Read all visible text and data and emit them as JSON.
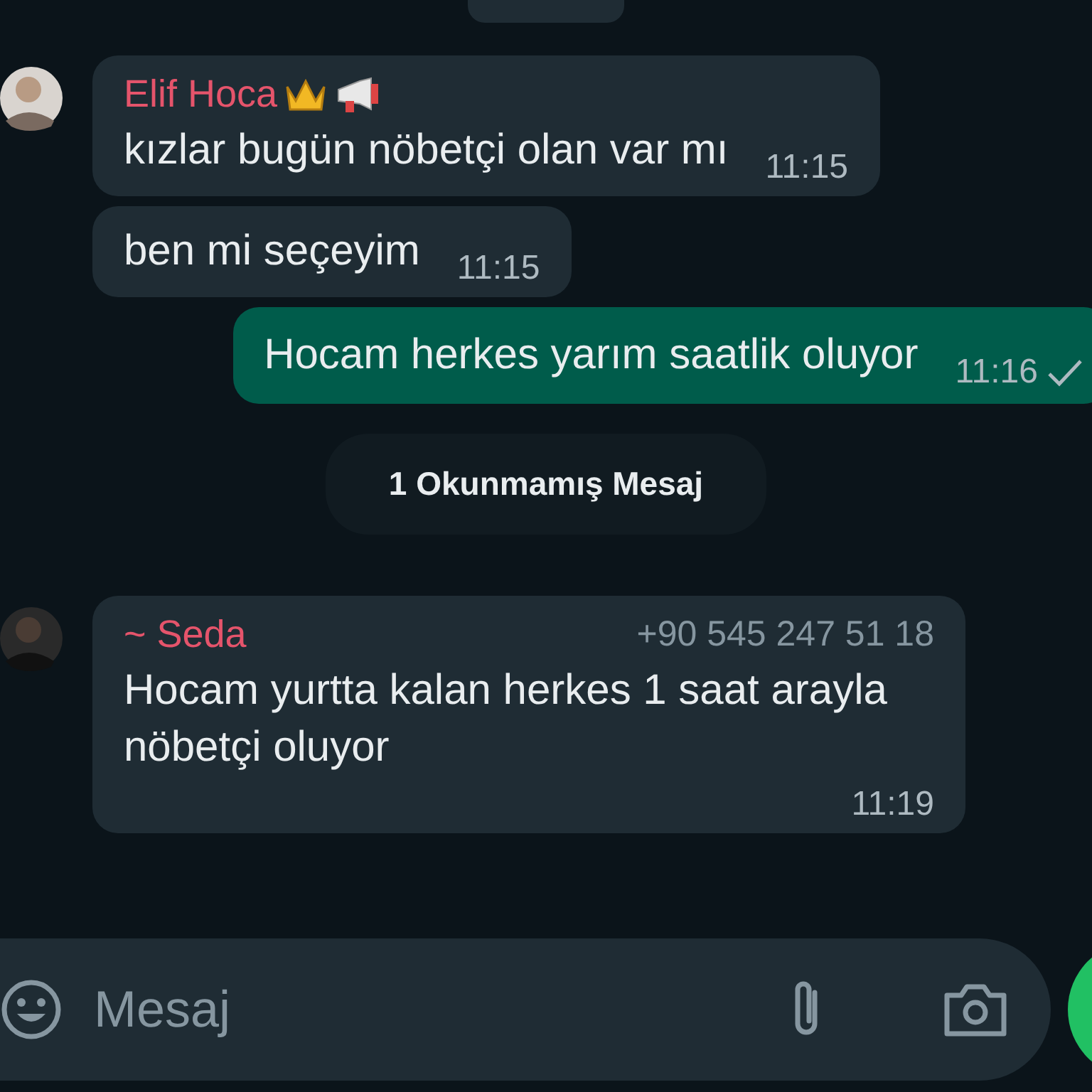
{
  "messages": [
    {
      "kind": "incoming",
      "sender": "Elif Hoca",
      "crown": true,
      "megaphone": true,
      "avatar": true,
      "text": "kızlar bugün nöbetçi olan var mı",
      "time": "11:15"
    },
    {
      "kind": "incoming",
      "text": "ben mi seçeyim",
      "time": "11:15"
    },
    {
      "kind": "outgoing",
      "text": "Hocam herkes yarım saatlik oluyor",
      "time": "11:16",
      "sent": true
    },
    {
      "kind": "unread",
      "text": "1 Okunmamış Mesaj"
    },
    {
      "kind": "incoming",
      "sender": "~ Seda",
      "phone": "+90 545 247 51 18",
      "avatar": true,
      "text": "Hocam yurtta kalan herkes 1 saat arayla nöbetçi oluyor",
      "time": "11:19"
    }
  ],
  "composer": {
    "placeholder": "Mesaj"
  }
}
